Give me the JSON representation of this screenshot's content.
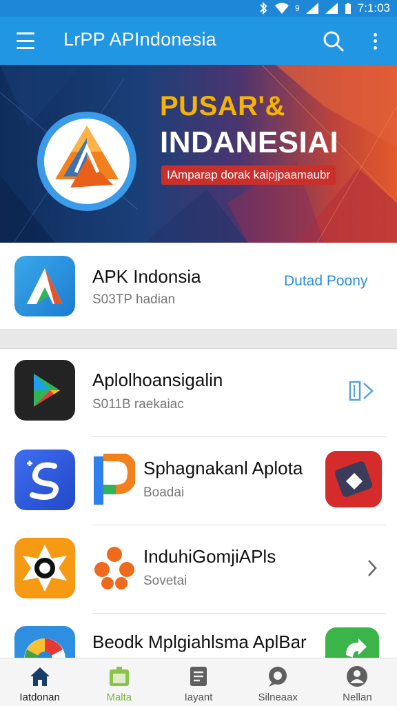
{
  "status_bar": {
    "time": "7:1:03",
    "signal_text": "9"
  },
  "app_bar": {
    "title": "LrPP APIndonesia"
  },
  "banner": {
    "title_line1": "PUSAR'&",
    "title_line2": "INDANESIAI",
    "tagline": "IAmparap dorak kaipjpaamaubr"
  },
  "featured": {
    "name": "APK Indonsia",
    "subtitle": "S03TP hadian",
    "action": "Dutad Poony"
  },
  "list": [
    {
      "name": "Aplolhoansigalin",
      "subtitle": "S011B raekaiac"
    },
    {
      "name": "Sphagnakanl Aplota",
      "subtitle": "Boadai"
    },
    {
      "name": "InduhiGomjiAPls",
      "subtitle": "Sovetai"
    },
    {
      "name": "Beodk Mplgiahlsma AplBar",
      "subtitle": ""
    }
  ],
  "bottom_nav": [
    {
      "label": "Iatdonan",
      "icon": "home-icon"
    },
    {
      "label": "Malta",
      "icon": "store-icon"
    },
    {
      "label": "Iayant",
      "icon": "document-icon"
    },
    {
      "label": "Silneaax",
      "icon": "chat-icon"
    },
    {
      "label": "Nellan",
      "icon": "profile-icon"
    }
  ],
  "colors": {
    "app_bar": "#2196e3",
    "accent": "#2a8ed6",
    "banner_gold": "#f5b400",
    "banner_tag": "#c9302c"
  }
}
